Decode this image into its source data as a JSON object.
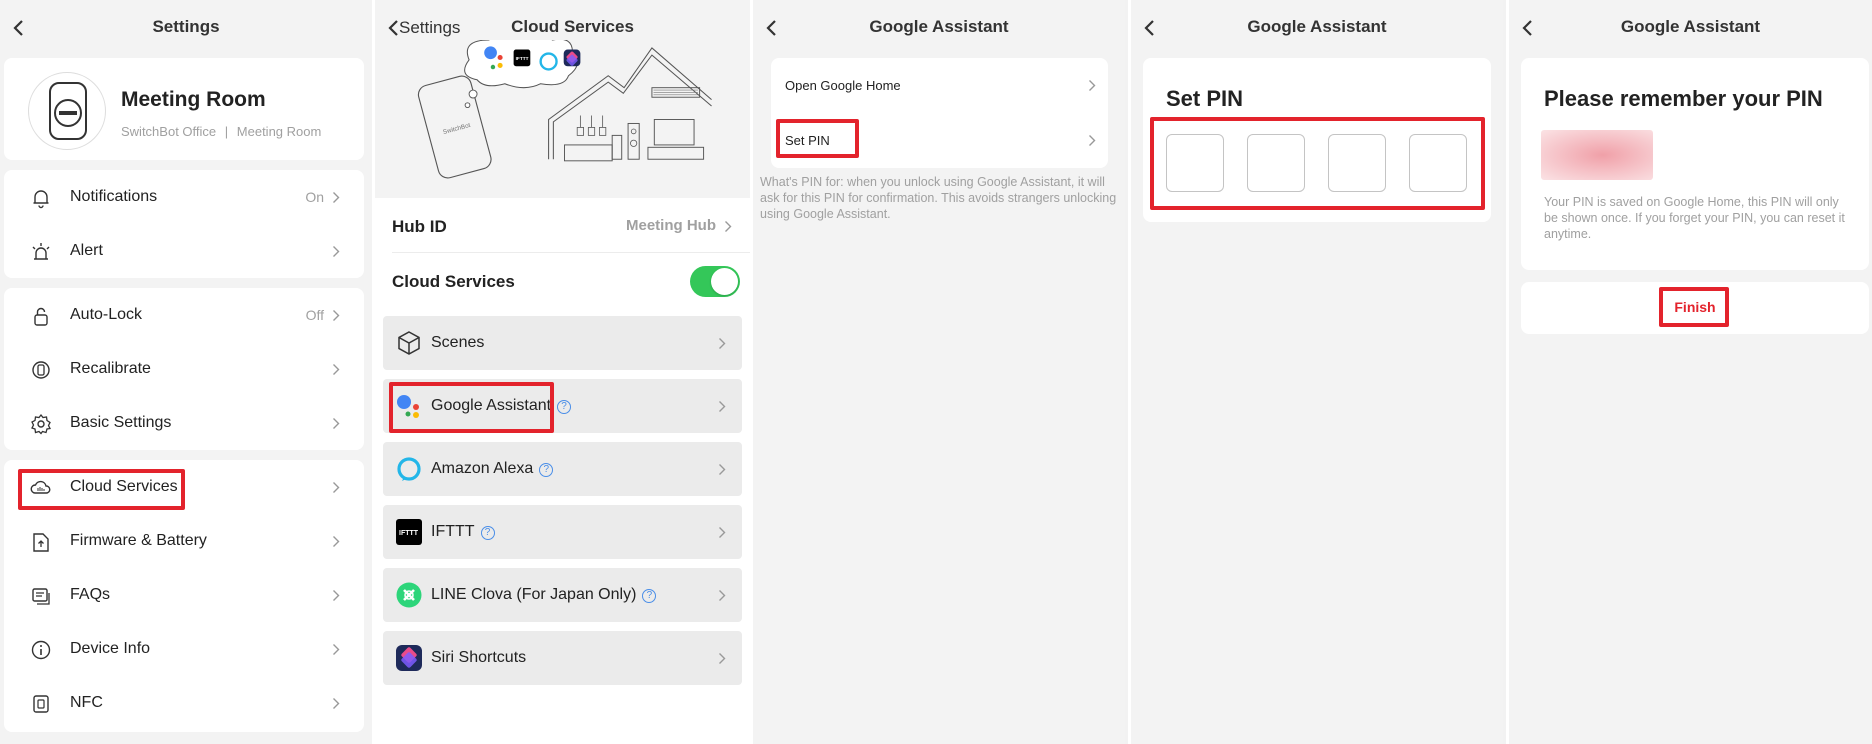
{
  "panel1": {
    "title": "Settings",
    "device": {
      "name": "Meeting Room",
      "location": "SwitchBot Office",
      "room": "Meeting Room",
      "separator": "|"
    },
    "items": [
      {
        "label": "Notifications",
        "value": "On",
        "icon": "bell-icon"
      },
      {
        "label": "Alert",
        "value": "",
        "icon": "alarm-light-icon"
      },
      {
        "label": "Auto-Lock",
        "value": "Off",
        "icon": "lock-icon"
      },
      {
        "label": "Recalibrate",
        "value": "",
        "icon": "recalibrate-icon"
      },
      {
        "label": "Basic Settings",
        "value": "",
        "icon": "gear-icon"
      },
      {
        "label": "Cloud Services",
        "value": "",
        "icon": "cloud-icon"
      },
      {
        "label": "Firmware & Battery",
        "value": "",
        "icon": "firmware-icon"
      },
      {
        "label": "FAQs",
        "value": "",
        "icon": "faq-icon"
      },
      {
        "label": "Device Info",
        "value": "",
        "icon": "info-icon"
      },
      {
        "label": "NFC",
        "value": "",
        "icon": "nfc-icon"
      }
    ]
  },
  "panel2": {
    "back_label": "Settings",
    "title": "Cloud Services",
    "hero_ifttt": "IFTTT",
    "hero_phone_brand": "SwitchBot",
    "hub_id_label": "Hub ID",
    "hub_id_value": "Meeting Hub",
    "cloud_label": "Cloud Services",
    "cloud_enabled": true,
    "services": [
      {
        "label": "Scenes",
        "icon": "scenes-icon",
        "help": false
      },
      {
        "label": "Google Assistant",
        "icon": "google-assistant-icon",
        "help": true
      },
      {
        "label": "Amazon Alexa",
        "icon": "alexa-icon",
        "help": true
      },
      {
        "label": "IFTTT",
        "icon": "ifttt-icon",
        "help": true
      },
      {
        "label": "LINE Clova (For Japan Only)",
        "icon": "line-clova-icon",
        "help": true
      },
      {
        "label": "Siri Shortcuts",
        "icon": "siri-shortcuts-icon",
        "help": false
      }
    ],
    "help_glyph": "?"
  },
  "panel3": {
    "title": "Google Assistant",
    "items": [
      {
        "label": "Open Google Home"
      },
      {
        "label": "Set PIN"
      }
    ],
    "note": "What's PIN for: when you unlock using Google Assistant, it will ask for this PIN for confirmation. This avoids strangers unlocking using Google Assistant."
  },
  "panel4": {
    "title": "Google Assistant",
    "heading": "Set PIN",
    "pin_slots": 4
  },
  "panel5": {
    "title": "Google Assistant",
    "heading": "Please remember your PIN",
    "note": "Your PIN is saved on Google Home, this PIN will only be shown once. If you forget your PIN, you can reset it anytime.",
    "finish_label": "Finish"
  },
  "colors": {
    "highlight": "#e3232c",
    "toggle_on": "#34c759",
    "finish_text": "#e3232c",
    "help_blue": "#4a8ee8"
  }
}
